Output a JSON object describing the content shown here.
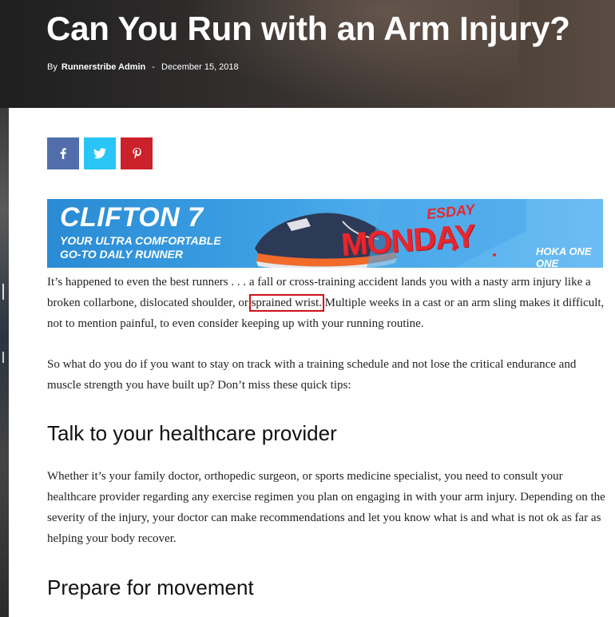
{
  "article": {
    "title": "Can You Run with an Arm Injury?",
    "by_label": "By",
    "author": "Runnerstribe Admin",
    "separator": "-",
    "date": "December 15, 2018"
  },
  "share": {
    "facebook_icon": "f",
    "twitter_icon": "twitter-bird",
    "pinterest_icon": "p"
  },
  "ad": {
    "headline": "CLIFTON 7",
    "tagline_line1": "YOUR ULTRA COMFORTABLE",
    "tagline_line2": "GO-TO DAILY RUNNER",
    "promo_top": "ESDAY",
    "promo_main": "MONDAY",
    "brand": "HOKA ONE ONE",
    "colors": {
      "background": "#3da0e4",
      "promo": "#e8262d"
    }
  },
  "body": {
    "p1_before": "It’s happened to even the best runners . . . a fall or cross-training accident lands you with a nasty arm injury like a broken collarbone, dislocated shoulder, or ",
    "p1_link": "sprained wrist.",
    "p1_after": " Multiple weeks in a cast or an arm sling makes it difficult, not to mention painful, to even consider keeping up with your running routine.",
    "p2": "So what do you do if you want to stay on track with a training schedule and not lose the critical endurance and muscle strength you have built up? Don’t miss these quick tips:",
    "h_talk": "Talk to your healthcare provider",
    "p3": "Whether it’s your family doctor, orthopedic surgeon, or sports medicine specialist, you need to consult your healthcare provider regarding any exercise regimen you plan on engaging in with your arm injury. Depending on the severity of the injury, your doctor can make recommendations and let you know what is and what is not ok as far as helping your body recover.",
    "h_prep": "Prepare for movement"
  },
  "colors": {
    "facebook": "#516eab",
    "twitter": "#29c5f6",
    "pinterest": "#ca212a",
    "highlight_box": "#d0121a"
  }
}
